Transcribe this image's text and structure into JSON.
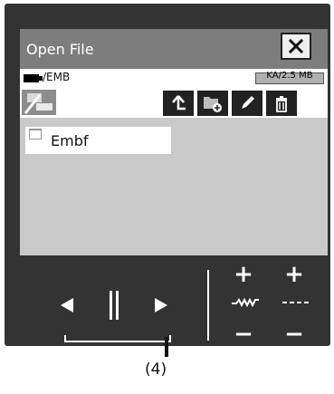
{
  "dialog": {
    "title": "Open File",
    "path": "/EMB",
    "capacity": "KA/2.5 MB",
    "close_icon": "close-icon"
  },
  "toolbar": {
    "icons": [
      "media-icon",
      "up-folder-icon",
      "new-folder-icon",
      "rename-pencil-icon",
      "trash-icon"
    ]
  },
  "files": [
    {
      "name": "Embf",
      "icon": "folder-icon"
    }
  ],
  "controls": {
    "prev_icon": "triangle-left-icon",
    "pause_icon": "pause-icon",
    "next_icon": "triangle-right-icon",
    "left_plus": "+",
    "right_plus": "+",
    "left_minus": "−",
    "right_minus": "−",
    "stitch_icon": "zigzag-stitch-icon",
    "length_icon": "straight-stitch-icon"
  },
  "callout": "(4)",
  "colors": {
    "panel": "#333333",
    "screen": "#c9c9c9",
    "titlebar": "#7d7d7d"
  }
}
